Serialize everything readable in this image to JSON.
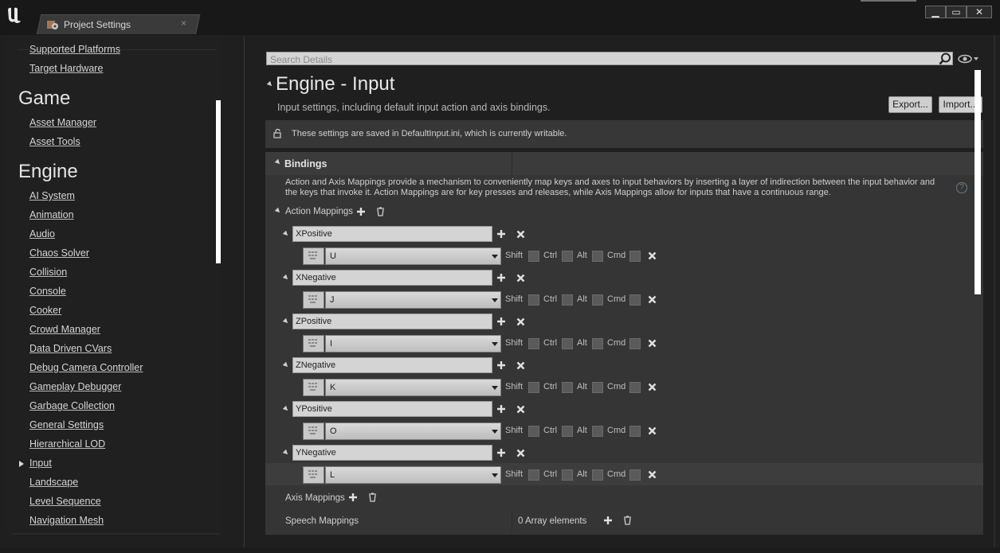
{
  "window": {
    "tab_title": "Project Settings",
    "tab_close": "×",
    "controls": {
      "minimize": "▁",
      "maximize": "▭",
      "close": "✕"
    }
  },
  "sidebar": {
    "partial_top_item": "Supported Platforms",
    "top_items": [
      "Target Hardware"
    ],
    "game_heading": "Game",
    "game_items": [
      "Asset Manager",
      "Asset Tools"
    ],
    "engine_heading": "Engine",
    "engine_items": [
      "AI System",
      "Animation",
      "Audio",
      "Chaos Solver",
      "Collision",
      "Console",
      "Cooker",
      "Crowd Manager",
      "Data Driven CVars",
      "Debug Camera Controller",
      "Gameplay Debugger",
      "Garbage Collection",
      "General Settings",
      "Hierarchical LOD",
      "Input",
      "Landscape",
      "Level Sequence",
      "Navigation Mesh"
    ],
    "selected_item": "Input"
  },
  "details": {
    "search_placeholder": "Search Details",
    "title": "Engine - Input",
    "subtitle": "Input settings, including default input action and axis bindings.",
    "export_label": "Export...",
    "import_label": "Import...",
    "info_text": "These settings are saved in DefaultInput.ini, which is currently writable.",
    "bindings_label": "Bindings",
    "bindings_desc": "Action and Axis Mappings provide a mechanism to conveniently map keys and axes to input behaviors by inserting a layer of indirection between the input behavior and the keys that invoke it. Action Mappings are for key presses and releases, while Axis Mappings allow for inputs that have a continuous range.",
    "action_mappings_label": "Action Mappings",
    "mappings": [
      {
        "name": "XPositive",
        "key": "U"
      },
      {
        "name": "XNegative",
        "key": "J"
      },
      {
        "name": "ZPositive",
        "key": "I"
      },
      {
        "name": "ZNegative",
        "key": "K"
      },
      {
        "name": "YPositive",
        "key": "O"
      },
      {
        "name": "YNegative",
        "key": "L"
      }
    ],
    "modifiers": {
      "shift": "Shift",
      "ctrl": "Ctrl",
      "alt": "Alt",
      "cmd": "Cmd"
    },
    "axis_mappings_label": "Axis Mappings",
    "speech_mappings_label": "Speech Mappings",
    "speech_count": "0 Array elements",
    "help_glyph": "?"
  },
  "colors": {
    "background": "#1e1e1e",
    "panel": "#353535",
    "field": "#d4d4d4"
  }
}
